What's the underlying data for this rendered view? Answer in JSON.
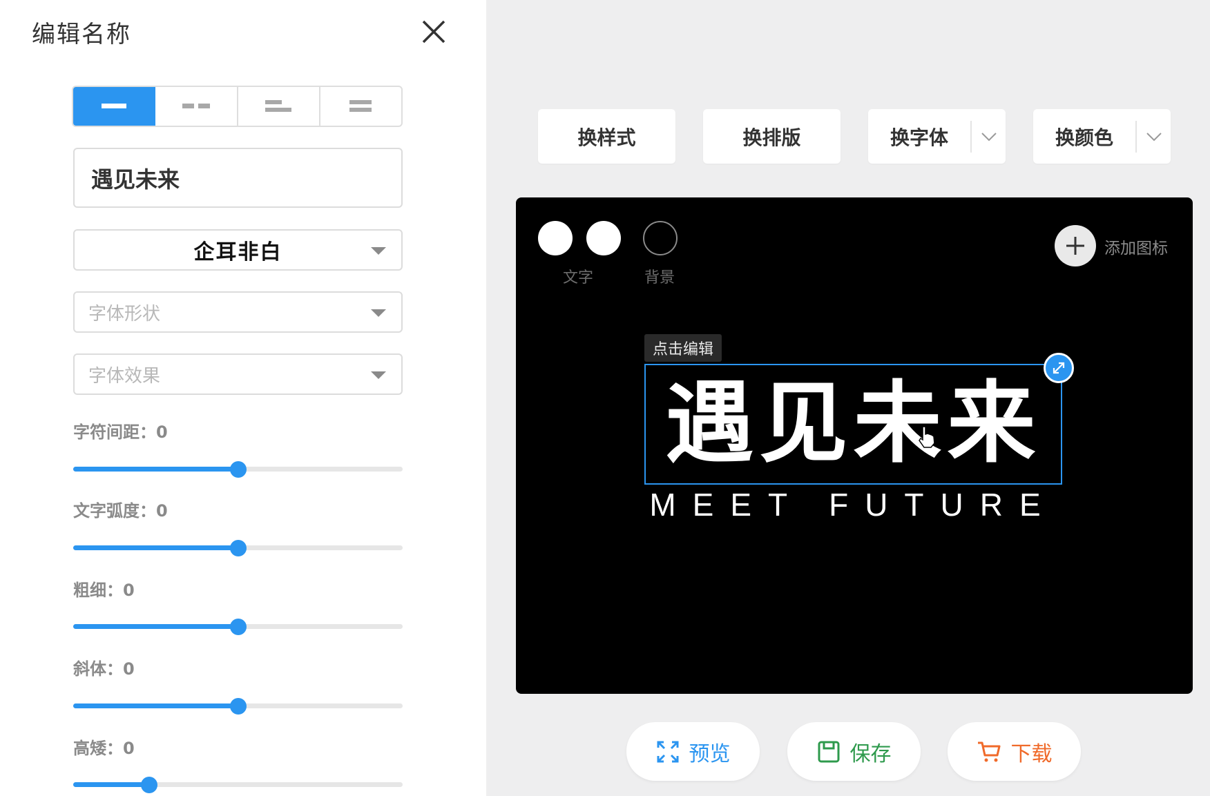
{
  "panel": {
    "title": "编辑名称",
    "layout_tabs": [
      {
        "name": "layout-single",
        "active": true
      },
      {
        "name": "layout-split",
        "active": false
      },
      {
        "name": "layout-left-align",
        "active": false
      },
      {
        "name": "layout-stacked",
        "active": false
      }
    ],
    "text_value": "遇见未来",
    "font_select": {
      "value": "企耳非白"
    },
    "shape_select": {
      "placeholder": "字体形状"
    },
    "effect_select": {
      "placeholder": "字体效果"
    },
    "sliders": [
      {
        "label": "字符间距：0",
        "level": 0.5
      },
      {
        "label": "文字弧度：0",
        "level": 0.5
      },
      {
        "label": "粗细：0",
        "level": 0.5
      },
      {
        "label": "斜体：0",
        "level": 0.5
      },
      {
        "label": "高矮：0",
        "level": 0.23
      }
    ]
  },
  "toolbar": {
    "change_style": "换样式",
    "change_layout": "换排版",
    "change_font": "换字体",
    "change_color": "换颜色"
  },
  "canvas": {
    "text_color_label": "文字",
    "bg_color_label": "背景",
    "add_icon_label": "添加图标",
    "edit_tag": "点击编辑",
    "logo_main": "遇见未来",
    "logo_sub": "MEET FUTURE",
    "colors": {
      "text": "#ffffff",
      "background": "#000000"
    }
  },
  "actions": {
    "preview": "预览",
    "save": "保存",
    "download": "下载"
  },
  "colors": {
    "accent": "#2b95f0",
    "preview": "#2b95f0",
    "save": "#2e9a4c",
    "download": "#f06a2a"
  }
}
